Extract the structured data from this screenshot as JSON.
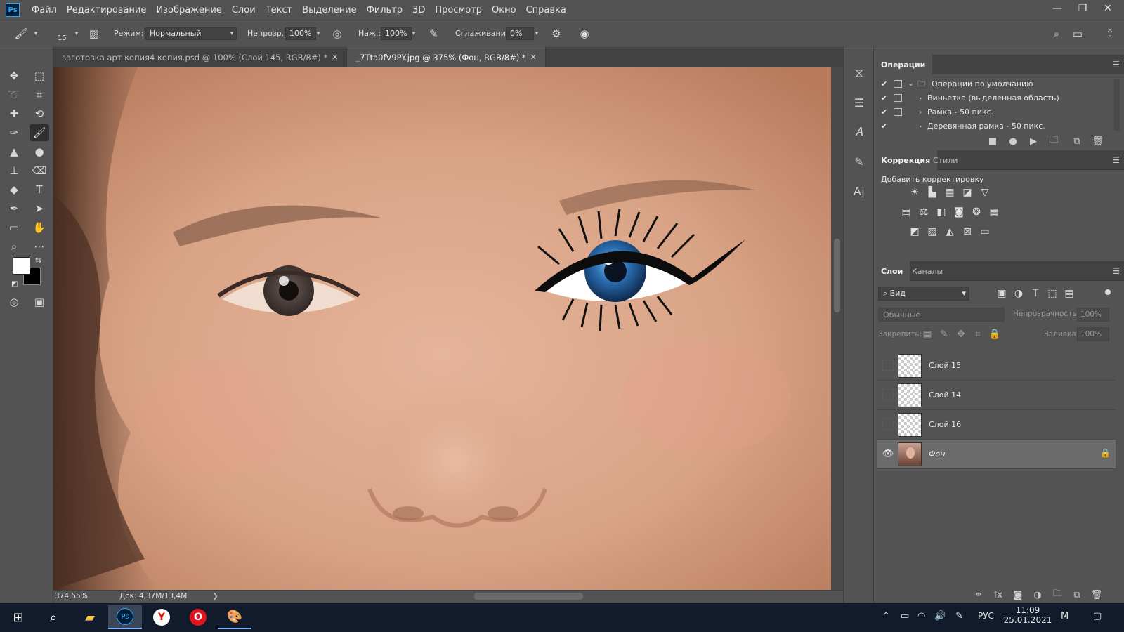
{
  "menu": [
    "Файл",
    "Редактирование",
    "Изображение",
    "Слои",
    "Текст",
    "Выделение",
    "Фильтр",
    "3D",
    "Просмотр",
    "Окно",
    "Справка"
  ],
  "app_logo": "Ps",
  "window_controls": {
    "minimize": "—",
    "restore": "❐",
    "close": "✕"
  },
  "options": {
    "brush_size": "15",
    "mode_label": "Режим:",
    "mode_value": "Нормальный",
    "opacity_label": "Непрозр.:",
    "opacity_value": "100%",
    "pressure_label": "Наж.:",
    "pressure_value": "100%",
    "smoothing_label": "Сглаживание:",
    "smoothing_value": "0%"
  },
  "tabs": [
    {
      "label": "заготовка арт копия4 копия.psd @ 100% (Слой 145, RGB/8#) *",
      "close": "✕"
    },
    {
      "label": "_7Tta0fV9PY.jpg @ 375% (Фон, RGB/8#) *",
      "close": "✕"
    }
  ],
  "status": {
    "zoom": "374,55%",
    "doc": "Док: 4,37M/13,4M",
    "arrow": "❯"
  },
  "actions_panel": {
    "title": "Операции",
    "items": [
      {
        "label": "Операции по умолчанию",
        "check": "✔"
      },
      {
        "label": "Виньетка (выделенная область)",
        "check": "✔"
      },
      {
        "label": "Рамка - 50 пикс.",
        "check": "✔"
      },
      {
        "label": "Деревянная рамка - 50 пикс.",
        "check": "✔"
      }
    ]
  },
  "adjustments_panel": {
    "tabs": [
      "Коррекция",
      "Стили"
    ],
    "heading": "Добавить корректировку"
  },
  "layers_panel": {
    "tabs": [
      "Слои",
      "Каналы"
    ],
    "filter_label": "Вид",
    "blend_mode": "Обычные",
    "opacity_label": "Непрозрачность:",
    "opacity_value": "100%",
    "lock_label": "Закрепить:",
    "fill_label": "Заливка:",
    "fill_value": "100%",
    "layers": [
      {
        "name": "Слой 15",
        "visible": false
      },
      {
        "name": "Слой 14",
        "visible": false
      },
      {
        "name": "Слой 16",
        "visible": false
      },
      {
        "name": "Фон",
        "visible": true,
        "locked": true,
        "selected": true
      }
    ]
  },
  "taskbar": {
    "lang": "РУС",
    "time": "11:09",
    "date": "25.01.2021"
  },
  "colors": {
    "foreground": "#ffffff",
    "background": "#000000",
    "accent": "#31a8ff"
  }
}
